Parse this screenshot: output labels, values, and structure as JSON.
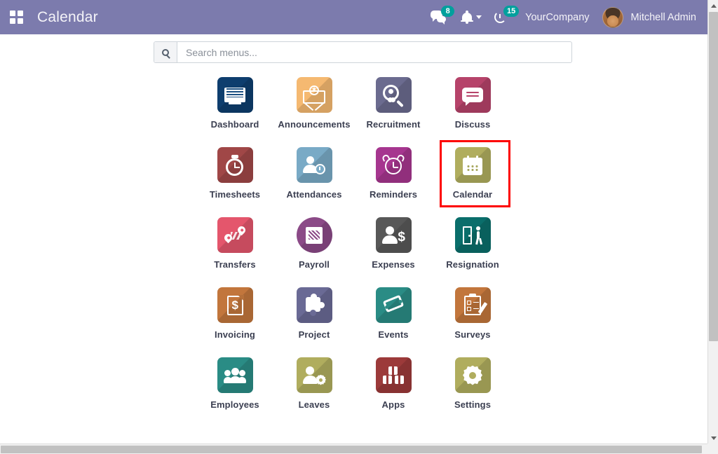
{
  "navbar": {
    "apps_menu_icon": "apps-grid-icon",
    "brand_title": "Calendar",
    "messages": {
      "icon": "chat-icon",
      "badge": "8"
    },
    "notifications": {
      "icon": "bell-icon",
      "caret": "chevron-down-icon"
    },
    "activities": {
      "icon": "activity-clock-icon",
      "badge": "15"
    },
    "company": "YourCompany",
    "user": "Mitchell Admin",
    "avatar_icon": "user-avatar"
  },
  "search": {
    "icon": "search-icon",
    "placeholder": "Search menus...",
    "value": ""
  },
  "colors": {
    "navbar_bg": "#7c7bad",
    "badge_bg": "#00a09d",
    "highlight_border": "#fd0000",
    "label_text": "#3b3f51"
  },
  "apps": {
    "highlighted": "Calendar",
    "rows": [
      [
        {
          "label": "Dashboard",
          "icon": "monitor-icon",
          "glyph": "g-monitor",
          "bg": "#0e3e6e",
          "shape": "square"
        },
        {
          "label": "Announcements",
          "icon": "envelope-medal-icon",
          "glyph": "g-envelope",
          "bg": "#f5b971",
          "shape": "square"
        },
        {
          "label": "Recruitment",
          "icon": "magnifier-user-icon",
          "glyph": "g-magnifier",
          "bg": "#6b6b8f",
          "shape": "square"
        },
        {
          "label": "Discuss",
          "icon": "speech-bubble-icon",
          "glyph": "g-speech",
          "bg": "#b6436a",
          "shape": "square"
        }
      ],
      [
        {
          "label": "Timesheets",
          "icon": "stopwatch-icon",
          "glyph": "g-stopwatch",
          "bg": "#a04747",
          "shape": "square"
        },
        {
          "label": "Attendances",
          "icon": "person-clock-icon",
          "glyph": "g-person-clock",
          "bg": "#79aac6",
          "shape": "square"
        },
        {
          "label": "Reminders",
          "icon": "alarm-clock-icon",
          "glyph": "g-alarm",
          "bg": "#a6368f",
          "shape": "square"
        },
        {
          "label": "Calendar",
          "icon": "calendar-icon",
          "glyph": "g-calendar",
          "bg": "#b0ad5e",
          "shape": "square"
        }
      ],
      [
        {
          "label": "Transfers",
          "icon": "map-pins-icon",
          "glyph": "g-pins",
          "bg": "#e4566c",
          "shape": "square"
        },
        {
          "label": "Payroll",
          "icon": "money-note-icon",
          "glyph": "g-bill",
          "bg": "#8b4a87",
          "shape": "round"
        },
        {
          "label": "Expenses",
          "icon": "person-dollar-icon",
          "glyph": "g-person-dollar",
          "bg": "#585858",
          "shape": "square"
        },
        {
          "label": "Resignation",
          "icon": "exit-door-icon",
          "glyph": "g-door",
          "bg": "#0a6e6b",
          "shape": "square"
        }
      ],
      [
        {
          "label": "Invoicing",
          "icon": "invoice-doc-icon",
          "glyph": "g-doc",
          "bg": "#c2763c",
          "shape": "square"
        },
        {
          "label": "Project",
          "icon": "puzzle-piece-icon",
          "glyph": "g-puzzle",
          "bg": "#6a6a95",
          "shape": "square"
        },
        {
          "label": "Events",
          "icon": "ticket-icon",
          "glyph": "g-ticket",
          "bg": "#2a8c85",
          "shape": "square"
        },
        {
          "label": "Surveys",
          "icon": "clipboard-pencil-icon",
          "glyph": "g-clipboard",
          "bg": "#c2763c",
          "shape": "square"
        }
      ],
      [
        {
          "label": "Employees",
          "icon": "people-group-icon",
          "glyph": "g-people",
          "bg": "#2a8c85",
          "shape": "square"
        },
        {
          "label": "Leaves",
          "icon": "person-gear-icon",
          "glyph": "g-person-gear",
          "bg": "#b0ad5e",
          "shape": "square"
        },
        {
          "label": "Apps",
          "icon": "boxes-icon",
          "glyph": "g-boxes",
          "bg": "#9c3a3a",
          "shape": "square"
        },
        {
          "label": "Settings",
          "icon": "gear-icon",
          "glyph": "g-gear",
          "bg": "#b0ad5e",
          "shape": "square"
        }
      ]
    ]
  },
  "scrollbars": {
    "vertical_up_icon": "scroll-up-arrow",
    "vertical_down_icon": "scroll-down-arrow"
  }
}
